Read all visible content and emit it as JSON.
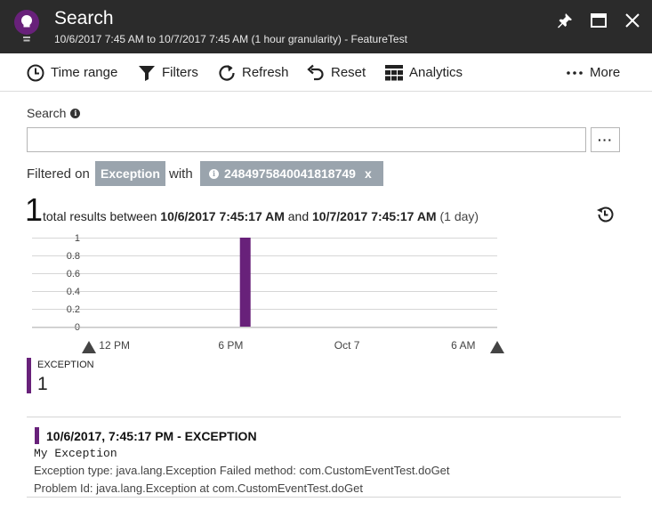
{
  "header": {
    "title": "Search",
    "subtitle": "10/6/2017 7:45 AM to 10/7/2017 7:45 AM (1 hour granularity) - FeatureTest",
    "icons": [
      "lightbulb-icon",
      "pin-icon",
      "maximize-icon",
      "close-icon"
    ]
  },
  "toolbar": {
    "time_range": "Time range",
    "filters": "Filters",
    "refresh": "Refresh",
    "reset": "Reset",
    "analytics": "Analytics",
    "more": "More"
  },
  "search": {
    "label": "Search",
    "value": "",
    "placeholder": "",
    "more_label": "···"
  },
  "filters": {
    "prefix": "Filtered on",
    "type_chip": "Exception",
    "with": "with",
    "id_chip": "2484975840041818749",
    "id_chip_close": "x"
  },
  "results": {
    "count": "1",
    "text_before": "total results between",
    "start": "10/6/2017 7:45:17 AM",
    "and": "and",
    "end": "10/7/2017 7:45:17 AM",
    "duration": "(1 day)"
  },
  "chart_data": {
    "type": "bar",
    "x_tick_labels": [
      "12 PM",
      "6 PM",
      "Oct 7",
      "6 AM"
    ],
    "y_tick_labels": [
      "1",
      "0.8",
      "0.6",
      "0.4",
      "0.2",
      "0"
    ],
    "ylim": [
      0,
      1
    ],
    "x_range_hours": [
      0,
      24
    ],
    "x_ticks_hours": [
      4.25,
      10.25,
      16.25,
      22.25
    ],
    "series": [
      {
        "name": "EXCEPTION",
        "color": "#68217a",
        "points": [
          {
            "hour": 11.0,
            "value": 1
          }
        ]
      }
    ],
    "grid": true
  },
  "legend": {
    "name": "EXCEPTION",
    "value": "1",
    "color": "#68217a"
  },
  "result_items": [
    {
      "title": "10/6/2017, 7:45:17 PM - EXCEPTION",
      "message": "My Exception",
      "detail": "Exception type: java.lang.Exception  Failed method: com.CustomEventTest.doGet",
      "detail2": "Problem Id: java.lang.Exception at com.CustomEventTest.doGet"
    }
  ],
  "colors": {
    "header_bg": "#2b2b2b",
    "chip_bg": "#9aa4ad",
    "accent": "#68217a"
  }
}
